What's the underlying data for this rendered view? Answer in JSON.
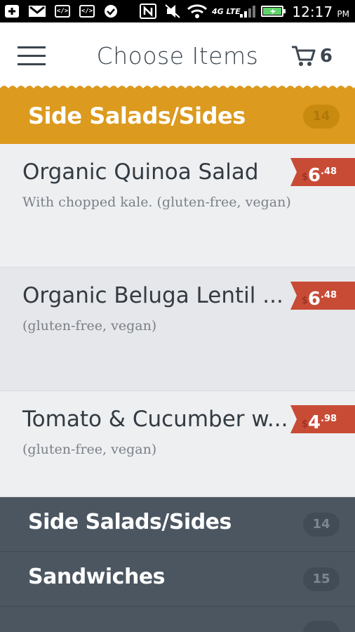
{
  "status_bar": {
    "time": "12:17",
    "ampm": "PM",
    "network": "4G LTE",
    "icons": [
      "add-icon",
      "gmail-icon",
      "code-icon",
      "code-icon",
      "check-icon",
      "nfc-icon",
      "mute-icon",
      "wifi-icon",
      "signal-icon",
      "battery-icon"
    ]
  },
  "header": {
    "title": "Choose Items",
    "cart_count": "6"
  },
  "active_category": {
    "title": "Side Salads/Sides",
    "count": "14"
  },
  "items": [
    {
      "name": "Organic Quinoa Salad",
      "description": "With chopped kale. (gluten-free, vegan)",
      "currency": "$",
      "price_whole": "6",
      "price_cents": ".48"
    },
    {
      "name": "Organic Beluga Lentil ...",
      "description": "(gluten-free, vegan)",
      "currency": "$",
      "price_whole": "6",
      "price_cents": ".48"
    },
    {
      "name": "Tomato & Cucumber w...",
      "description": "(gluten-free, vegan)",
      "currency": "$",
      "price_whole": "4",
      "price_cents": ".98"
    }
  ],
  "categories": [
    {
      "title": "Side Salads/Sides",
      "count": "14"
    },
    {
      "title": "Sandwiches",
      "count": "15"
    }
  ],
  "colors": {
    "accent": "#dc9a1e",
    "price_tag": "#c84b36",
    "dark_panel": "#4b5661",
    "text": "#333b42"
  }
}
